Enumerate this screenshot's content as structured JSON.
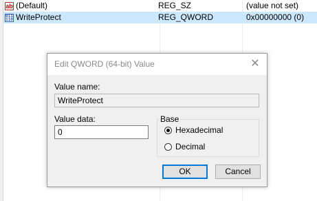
{
  "registry_list": {
    "rows": [
      {
        "icon": "string-value-icon",
        "icon_text": "ab",
        "name": "(Default)",
        "type": "REG_SZ",
        "data": "(value not set)",
        "selected": false
      },
      {
        "icon": "binary-value-icon",
        "icon_text": "011\n110",
        "name": "WriteProtect",
        "type": "REG_QWORD",
        "data": "0x00000000 (0)",
        "selected": true
      }
    ]
  },
  "dialog": {
    "title": "Edit QWORD (64-bit) Value",
    "close_glyph": "✕",
    "value_name_label": "Value name:",
    "value_name": "WriteProtect",
    "value_data_label": "Value data:",
    "value_data": "0",
    "base_label": "Base",
    "base_options": [
      {
        "label": "Hexadecimal",
        "selected": true
      },
      {
        "label": "Decimal",
        "selected": false
      }
    ],
    "ok_label": "OK",
    "cancel_label": "Cancel"
  },
  "colors": {
    "selection": "#cce8ff",
    "dialog_bg": "#f0f0f0",
    "accent": "#0078d7"
  }
}
